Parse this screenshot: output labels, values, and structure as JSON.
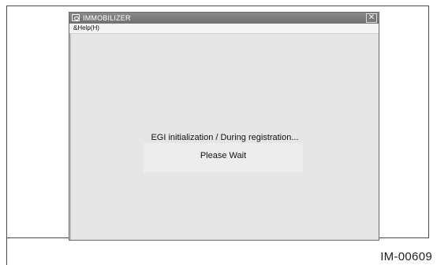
{
  "window": {
    "title": "IMMOBILIZER",
    "close_glyph": "✕",
    "app_icon": "camera-icon"
  },
  "menubar": {
    "items": [
      {
        "label": "&Help(H)"
      }
    ]
  },
  "content": {
    "status_message": "EGI initialization / During registration...",
    "wait_label": "Please Wait"
  },
  "figure_code": "IM-00609"
}
